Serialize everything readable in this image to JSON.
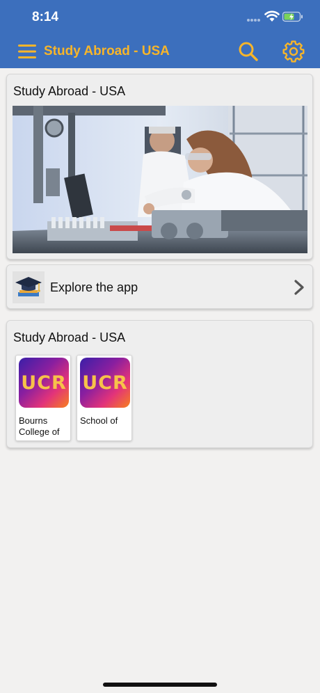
{
  "status_bar": {
    "time": "8:14"
  },
  "nav": {
    "title": "Study Abroad - USA",
    "menu_icon": "hamburger-menu-icon",
    "search_icon": "search-icon",
    "settings_icon": "gear-icon"
  },
  "colors": {
    "header_bg": "#3c6fbd",
    "accent": "#f7b52a",
    "page_bg": "#f2f1f0"
  },
  "hero_card": {
    "title": "Study Abroad - USA",
    "image_desc": "lab-researchers-photo"
  },
  "explore_card": {
    "label": "Explore the app",
    "icon": "graduation-cap-icon"
  },
  "list_card": {
    "title": "Study Abroad - USA",
    "tiles": [
      {
        "logo_text": "UCR",
        "label": "Bourns College of"
      },
      {
        "logo_text": "UCR",
        "label": "School of"
      }
    ]
  }
}
